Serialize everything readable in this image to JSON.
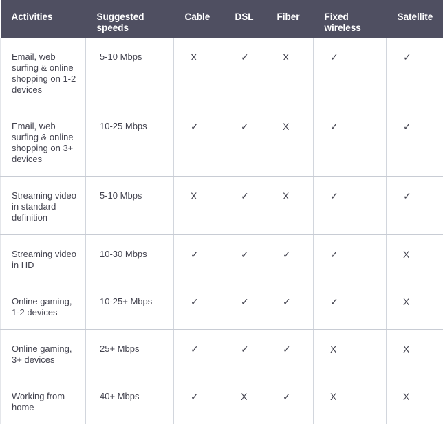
{
  "table": {
    "name": "internet-speed-recommendations",
    "columns": [
      {
        "key": "activities",
        "label": "Activities"
      },
      {
        "key": "speeds",
        "label": "Suggested speeds"
      },
      {
        "key": "cable",
        "label": "Cable"
      },
      {
        "key": "dsl",
        "label": "DSL"
      },
      {
        "key": "fiber",
        "label": "Fiber"
      },
      {
        "key": "fixed",
        "label": "Fixed wireless"
      },
      {
        "key": "satellite",
        "label": "Satellite"
      }
    ],
    "symbols": {
      "yes": "✓",
      "no": "X"
    },
    "colors": {
      "header_background": "#4f4f61",
      "header_text": "#ffffff",
      "body_text": "#43434f",
      "row_divider": "#c8ccd4",
      "column_divider": "#d2d6dd",
      "cell_background": "#ffffff"
    },
    "rows": [
      {
        "activity": "Email, web surfing & online shopping on 1-2 devices",
        "speed": "5-10 Mbps",
        "cable": "X",
        "dsl": "✓",
        "fiber": "X",
        "fixed": "✓",
        "satellite": "✓"
      },
      {
        "activity": "Email, web surfing & online shopping on 3+ devices",
        "speed": "10-25 Mbps",
        "cable": "✓",
        "dsl": "✓",
        "fiber": "X",
        "fixed": "✓",
        "satellite": "✓"
      },
      {
        "activity": "Streaming video in standard definition",
        "speed": "5-10 Mbps",
        "cable": "X",
        "dsl": "✓",
        "fiber": "X",
        "fixed": "✓",
        "satellite": "✓"
      },
      {
        "activity": "Streaming video in HD",
        "speed": "10-30 Mbps",
        "cable": "✓",
        "dsl": "✓",
        "fiber": "✓",
        "fixed": "✓",
        "satellite": "X"
      },
      {
        "activity": "Online gaming, 1-2 devices",
        "speed": "10-25+ Mbps",
        "cable": "✓",
        "dsl": "✓",
        "fiber": "✓",
        "fixed": "✓",
        "satellite": "X"
      },
      {
        "activity": "Online gaming, 3+ devices",
        "speed": "25+ Mbps",
        "cable": "✓",
        "dsl": "✓",
        "fiber": "✓",
        "fixed": "X",
        "satellite": "X"
      },
      {
        "activity": "Working from home",
        "speed": "40+ Mbps",
        "cable": "✓",
        "dsl": "X",
        "fiber": "✓",
        "fixed": "X",
        "satellite": "X"
      }
    ]
  }
}
